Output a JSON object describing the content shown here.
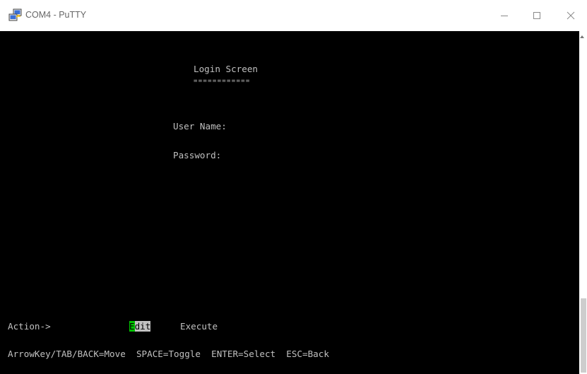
{
  "window": {
    "title": "COM4 - PuTTY",
    "app_icon": "putty-icon",
    "controls": {
      "minimize_glyph": "—",
      "maximize_glyph": "☐",
      "close_glyph": "✕"
    }
  },
  "terminal": {
    "background": "#000000",
    "foreground": "#c0c0c0",
    "cursor_color": "#00c000",
    "screen_title": "Login Screen",
    "screen_title_underline": "============",
    "username_label": "User Name:",
    "password_label": "Password:",
    "action_label": "Action->",
    "actions": {
      "edit_first": "E",
      "edit_rest": "dit",
      "execute": "Execute"
    },
    "help_line": "ArrowKey/TAB/BACK=Move  SPACE=Toggle  ENTER=Select  ESC=Back"
  }
}
